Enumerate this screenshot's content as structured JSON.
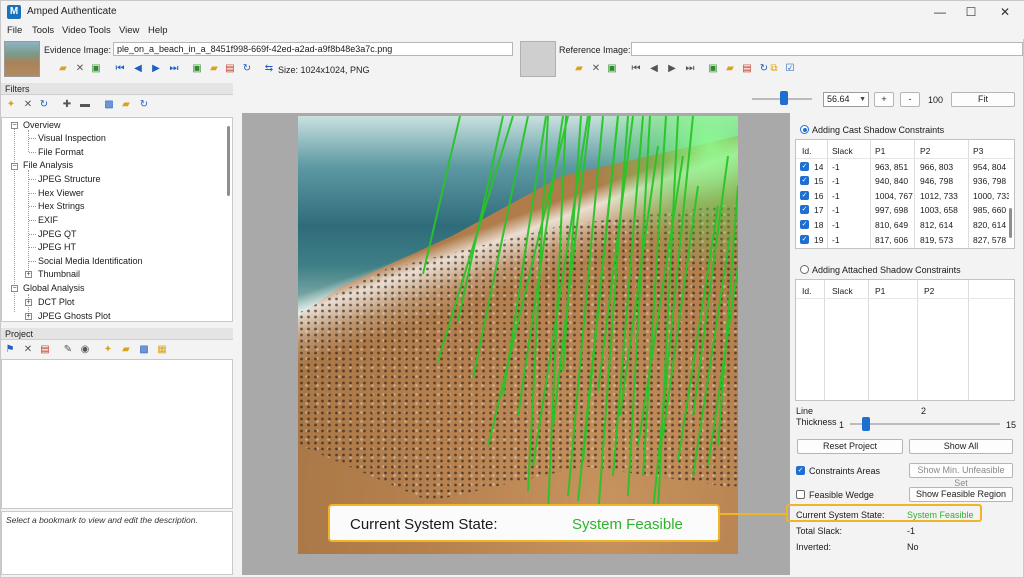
{
  "window": {
    "title": "Amped Authenticate",
    "logo_letter": "M"
  },
  "window_controls": {
    "minimize": "—",
    "maximize": "☐",
    "close": "✕"
  },
  "menu": [
    "File",
    "Tools",
    "Video Tools",
    "View",
    "Help"
  ],
  "evidence": {
    "label": "Evidence Image:",
    "filename": "ple_on_a_beach_in_a_8451f998-669f-42ed-a2ad-a9f8b48e3a7c.png",
    "size_text": "Size: 1024x1024, PNG"
  },
  "reference": {
    "label": "Reference Image:",
    "filename": ""
  },
  "filters": {
    "header": "Filters",
    "items": [
      {
        "label": "Overview",
        "level": 0,
        "expander": "−"
      },
      {
        "label": "Visual Inspection",
        "level": 1
      },
      {
        "label": "File Format",
        "level": 1
      },
      {
        "label": "File Analysis",
        "level": 0,
        "expander": "−"
      },
      {
        "label": "JPEG Structure",
        "level": 1
      },
      {
        "label": "Hex Viewer",
        "level": 1
      },
      {
        "label": "Hex Strings",
        "level": 1
      },
      {
        "label": "EXIF",
        "level": 1
      },
      {
        "label": "JPEG QT",
        "level": 1
      },
      {
        "label": "JPEG HT",
        "level": 1
      },
      {
        "label": "Social Media Identification",
        "level": 1
      },
      {
        "label": "Thumbnail",
        "level": 1,
        "expander": "+"
      },
      {
        "label": "Global Analysis",
        "level": 0,
        "expander": "−"
      },
      {
        "label": "DCT Plot",
        "level": 1,
        "expander": "+"
      },
      {
        "label": "JPEG Ghosts Plot",
        "level": 1,
        "expander": "+"
      }
    ]
  },
  "project": {
    "header": "Project",
    "description_placeholder": "Select a bookmark to view and edit the description."
  },
  "zoom": {
    "value": "56.64",
    "plus": "+",
    "minus": "-",
    "percent": "100",
    "fit": "Fit"
  },
  "cast_shadow": {
    "title": "Adding Cast Shadow Constraints",
    "columns": [
      "Id.",
      "Slack",
      "P1",
      "P2",
      "P3"
    ],
    "rows": [
      {
        "id": "14",
        "slack": "-1",
        "p1": "963, 851",
        "p2": "966, 803",
        "p3": "954, 804"
      },
      {
        "id": "15",
        "slack": "-1",
        "p1": "940, 840",
        "p2": "946, 798",
        "p3": "936, 798"
      },
      {
        "id": "16",
        "slack": "-1",
        "p1": "1004, 767",
        "p2": "1012, 733",
        "p3": "1000, 733"
      },
      {
        "id": "17",
        "slack": "-1",
        "p1": "997, 698",
        "p2": "1003, 658",
        "p3": "985, 660"
      },
      {
        "id": "18",
        "slack": "-1",
        "p1": "810, 649",
        "p2": "812, 614",
        "p3": "820, 614"
      },
      {
        "id": "19",
        "slack": "-1",
        "p1": "817, 606",
        "p2": "819, 573",
        "p3": "827, 578"
      }
    ]
  },
  "attached_shadow": {
    "title": "Adding Attached Shadow Constraints",
    "columns": [
      "Id.",
      "Slack",
      "P1",
      "P2"
    ]
  },
  "line_thickness": {
    "label_line1": "Line",
    "label_line2": "Thickness",
    "value": "2",
    "min": "1",
    "max": "15"
  },
  "buttons": {
    "reset_project": "Reset Project",
    "show_all": "Show All",
    "show_min_unfeasible": "Show Min. Unfeasible Set",
    "show_feasible_region": "Show Feasible Region"
  },
  "options": {
    "constraints_areas": "Constraints Areas",
    "feasible_wedge": "Feasible Wedge"
  },
  "status": {
    "state_label": "Current System State:",
    "state_value": "System Feasible",
    "slack_label": "Total Slack:",
    "slack_value": "-1",
    "inverted_label": "Inverted:",
    "inverted_value": "No"
  },
  "callout": {
    "label": "Current System State:",
    "value": "System Feasible"
  },
  "colors": {
    "accent": "#1f6fd1",
    "feasible": "#2db32d",
    "highlight": "#f0b429",
    "lines": "#27c527"
  }
}
